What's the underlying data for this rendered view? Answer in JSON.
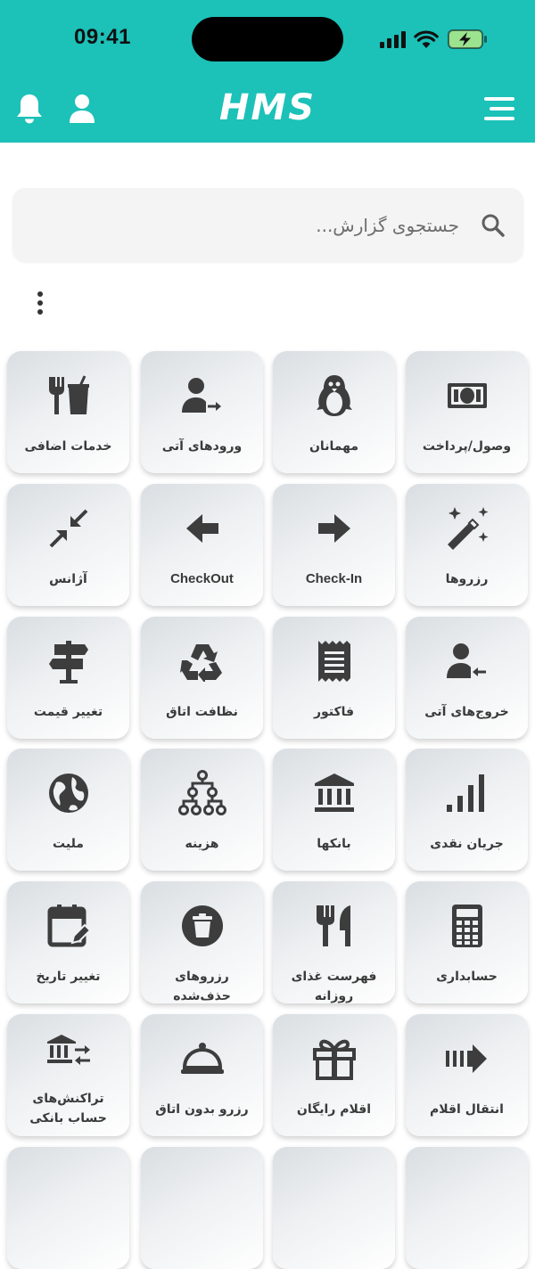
{
  "status_bar": {
    "time": "09:41"
  },
  "header": {
    "app_title": "HMS",
    "colors": {
      "header_bg": "#1cc1b8",
      "icon": "#ffffff"
    }
  },
  "search": {
    "placeholder": "جستجوی گزارش..."
  },
  "menu_tiles": [
    {
      "label": "وصول/پرداخت",
      "icon": "cash-icon"
    },
    {
      "label": "مهمانان",
      "icon": "penguin-icon"
    },
    {
      "label": "ورودهای آتی",
      "icon": "user-arrow-right-icon"
    },
    {
      "label": "خدمات اضافی",
      "icon": "food-drink-icon"
    },
    {
      "label": "رزروها",
      "icon": "magic-wand-icon"
    },
    {
      "label": "Check-In",
      "icon": "arrow-right-icon"
    },
    {
      "label": "CheckOut",
      "icon": "arrow-left-icon"
    },
    {
      "label": "آژانس",
      "icon": "compress-arrows-icon"
    },
    {
      "label": "خروج‌های آتی",
      "icon": "user-arrow-left-icon"
    },
    {
      "label": "فاکتور",
      "icon": "receipt-icon"
    },
    {
      "label": "نظافت اتاق",
      "icon": "recycle-icon"
    },
    {
      "label": "تغییر قیمت",
      "icon": "signpost-icon"
    },
    {
      "label": "جریان نقدی",
      "icon": "signal-bars-icon"
    },
    {
      "label": "بانکها",
      "icon": "bank-icon"
    },
    {
      "label": "هزینه",
      "icon": "hierarchy-icon"
    },
    {
      "label": "ملیت",
      "icon": "globe-icon"
    },
    {
      "label": "حسابداری",
      "icon": "calculator-icon"
    },
    {
      "label": "فهرست غذای روزانه",
      "icon": "utensils-icon"
    },
    {
      "label": "رزروهای حذف‌شده",
      "icon": "trash-icon"
    },
    {
      "label": "تغییر تاریخ",
      "icon": "calendar-edit-icon"
    },
    {
      "label": "انتقال اقلام",
      "icon": "transfer-arrow-icon"
    },
    {
      "label": "اقلام رایگان",
      "icon": "gift-icon"
    },
    {
      "label": "رزرو بدون اتاق",
      "icon": "cloche-icon"
    },
    {
      "label": "تراکنش‌های حساب بانکی",
      "icon": "bank-transfer-icon"
    }
  ]
}
